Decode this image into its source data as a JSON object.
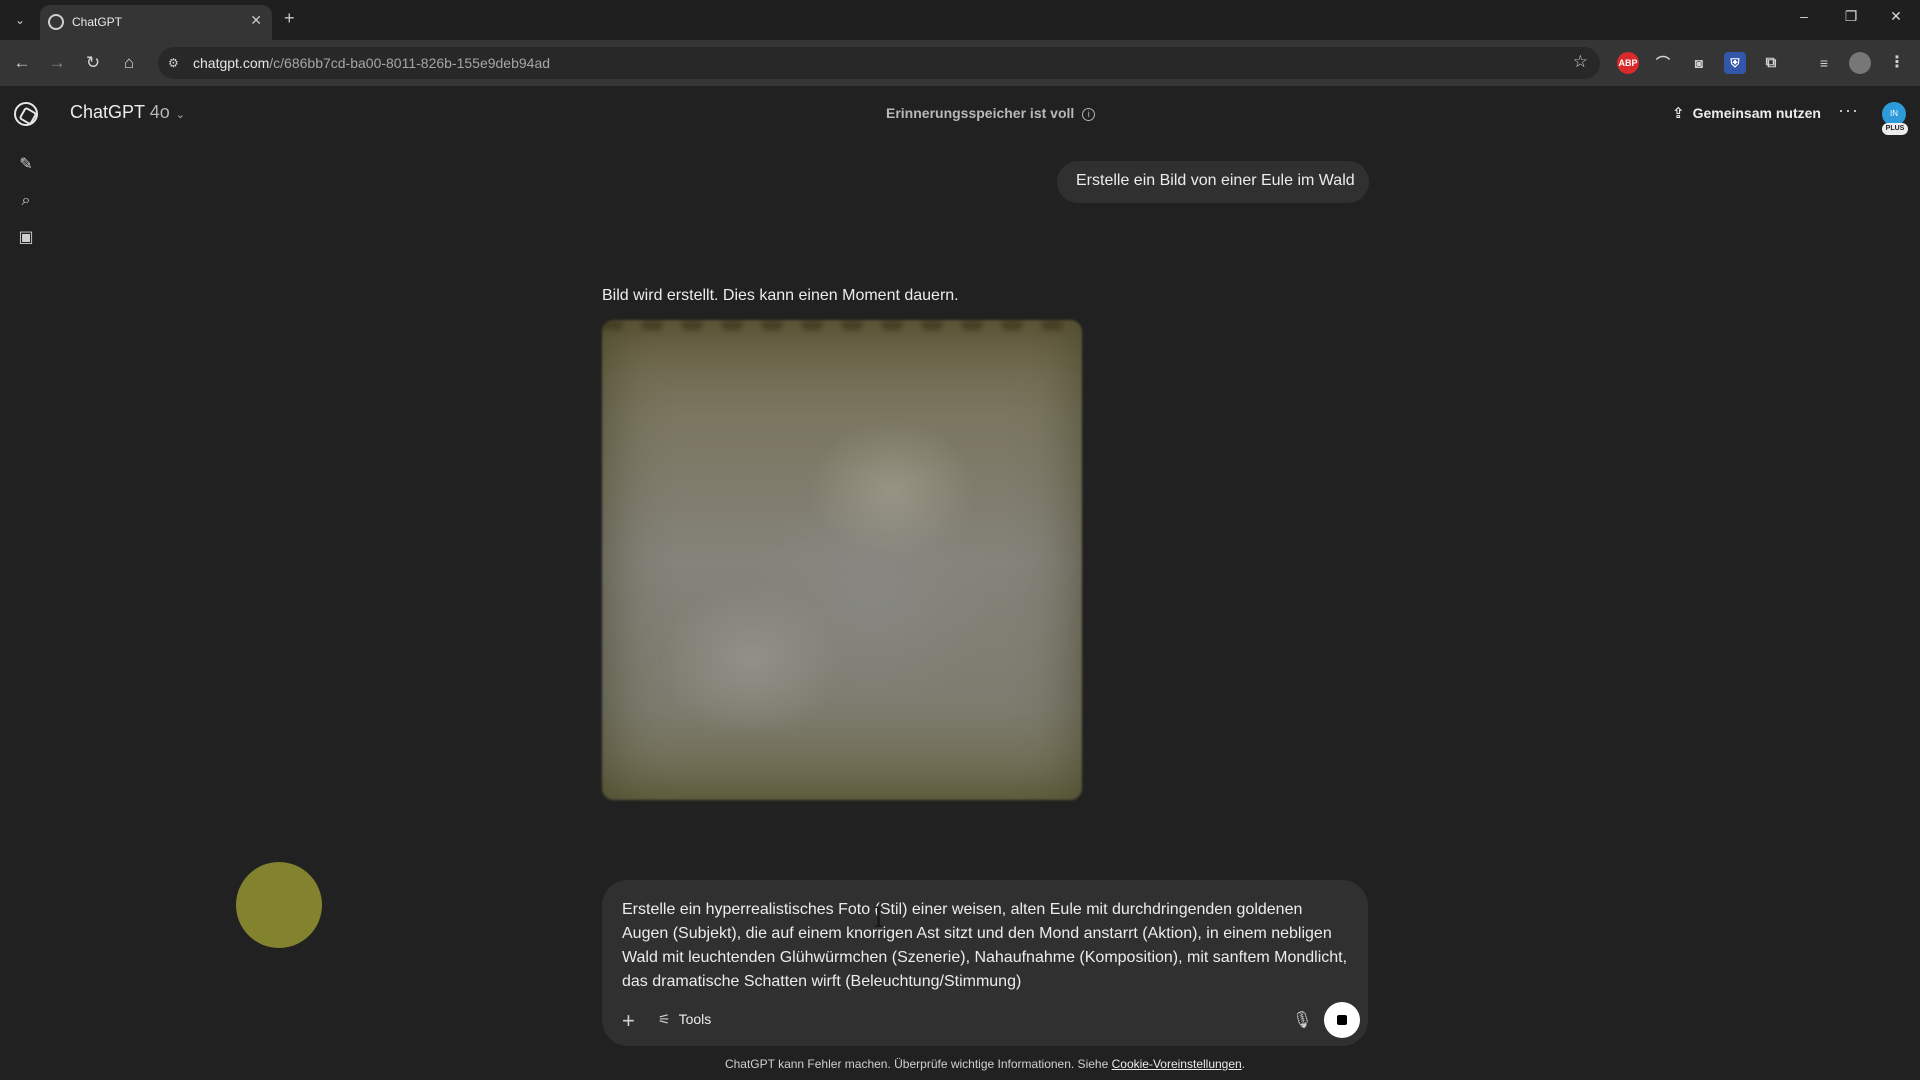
{
  "browser": {
    "tab_title": "ChatGPT",
    "url_host": "chatgpt.com",
    "url_path": "/c/686bb7cd-ba00-8011-826b-155e9deb94ad",
    "extensions": [
      {
        "name": "adblock-icon",
        "label": "ABP",
        "color": "#d82a2a"
      },
      {
        "name": "extension-arrow-icon",
        "label": "",
        "color": "#353535"
      },
      {
        "name": "camera-icon",
        "label": "",
        "color": "#353535"
      },
      {
        "name": "extension-shield-icon",
        "label": "",
        "color": "#3355aa"
      },
      {
        "name": "puzzle-icon",
        "label": "",
        "color": "#353535"
      }
    ]
  },
  "header": {
    "model_name": "ChatGPT",
    "model_version": "4o",
    "memory_status": "Erinnerungsspeicher ist voll",
    "share_label": "Gemeinsam nutzen",
    "avatar_initials": "IN",
    "plan_badge": "PLUS"
  },
  "conversation": {
    "user_message": "Erstelle ein Bild von einer Eule im Wald",
    "assistant_status": "Bild wird erstellt. Dies kann einen Moment dauern."
  },
  "composer": {
    "text": "Erstelle ein hyperrealistisches Foto (Stil) einer weisen, alten Eule mit durchdringenden goldenen Augen (Subjekt), die auf einem knorrigen Ast sitzt und den Mond anstarrt (Aktion), in einem nebligen Wald mit leuchtenden Glühwürmchen (Szenerie), Nahaufnahme (Komposition), mit sanftem Mondlicht, das dramatische Schatten wirft (Beleuchtung/Stimmung)",
    "tools_label": "Tools"
  },
  "footer": {
    "text": "ChatGPT kann Fehler machen. Überprüfe wichtige Informationen. Siehe",
    "link": "Cookie-Voreinstellungen",
    "suffix": "."
  },
  "colors": {
    "background": "#212121",
    "bubble": "#303030",
    "avatar": "#2d9bd9"
  }
}
